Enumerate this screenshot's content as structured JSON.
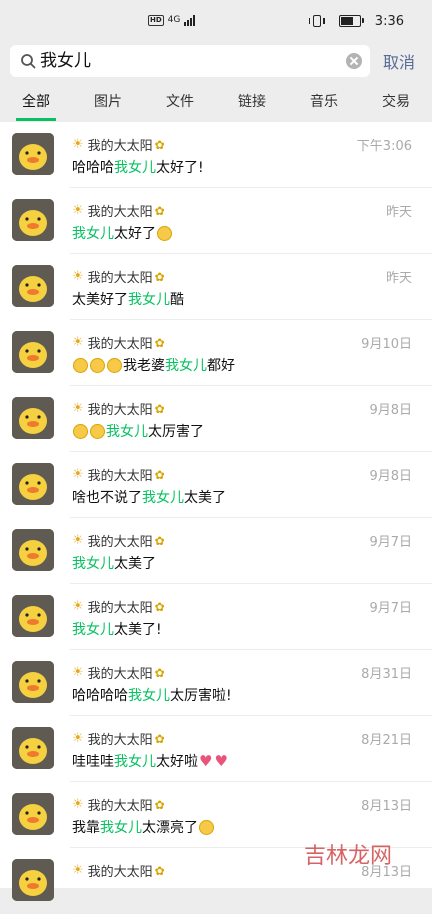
{
  "status_bar": {
    "net_badge": "HD",
    "net_type": "4G",
    "time": "3:36"
  },
  "search": {
    "query": "我女儿",
    "cancel_label": "取消"
  },
  "tabs": [
    "全部",
    "图片",
    "文件",
    "链接",
    "音乐",
    "交易"
  ],
  "active_tab": 0,
  "results": [
    {
      "sender": "我的大太阳",
      "time": "下午3:06",
      "before": "哈哈哈 ",
      "highlight": "我女儿",
      "after": "太好了!",
      "emojis": []
    },
    {
      "sender": "我的大太阳",
      "time": "昨天",
      "before": "",
      "highlight": "我女儿",
      "after": "太好了",
      "emojis": [
        "face"
      ]
    },
    {
      "sender": "我的大太阳",
      "time": "昨天",
      "before": "太美好了 ",
      "highlight": "我女儿",
      "after": " 酷",
      "emojis": []
    },
    {
      "sender": "我的大太阳",
      "time": "9月10日",
      "before": "我老婆",
      "highlight": "我女儿",
      "after": "都好",
      "lead_emojis": [
        "face",
        "face",
        "face"
      ],
      "emojis": []
    },
    {
      "sender": "我的大太阳",
      "time": "9月8日",
      "before": "",
      "highlight": "我女儿",
      "after": "太厉害了",
      "lead_emojis": [
        "face",
        "face"
      ],
      "emojis": []
    },
    {
      "sender": "我的大太阳",
      "time": "9月8日",
      "before": "啥也不说了 ",
      "highlight": "我女儿",
      "after": "太美了",
      "emojis": []
    },
    {
      "sender": "我的大太阳",
      "time": "9月7日",
      "before": "",
      "highlight": "我女儿",
      "after": "太美了",
      "emojis": []
    },
    {
      "sender": "我的大太阳",
      "time": "9月7日",
      "before": "",
      "highlight": "我女儿",
      "after": "太美了!",
      "emojis": []
    },
    {
      "sender": "我的大太阳",
      "time": "8月31日",
      "before": "哈哈哈哈 ",
      "highlight": "我女儿",
      "after": "太厉害啦!",
      "emojis": []
    },
    {
      "sender": "我的大太阳",
      "time": "8月21日",
      "before": "哇哇哇 ",
      "highlight": "我女儿",
      "after": "太好啦",
      "emojis": [
        "heart",
        "heart"
      ]
    },
    {
      "sender": "我的大太阳",
      "time": "8月13日",
      "before": "我靠 ",
      "highlight": "我女儿",
      "after": "太漂亮了 ",
      "emojis": [
        "face"
      ]
    },
    {
      "sender": "我的大太阳",
      "time": "8月13日",
      "before": "",
      "highlight": "",
      "after": "",
      "emojis": []
    }
  ],
  "watermark": "吉林龙网",
  "colors": {
    "accent": "#07c160",
    "link": "#576b95",
    "background": "#ededed"
  }
}
